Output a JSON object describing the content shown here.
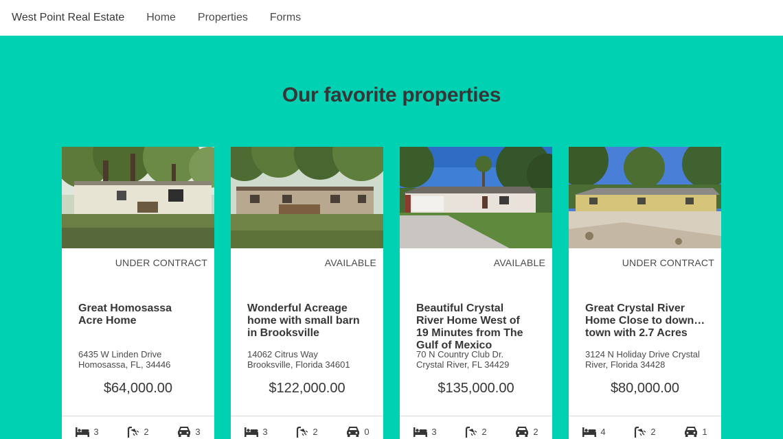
{
  "nav": {
    "brand": "West Point Real Estate",
    "links": [
      "Home",
      "Properties",
      "Forms"
    ]
  },
  "hero": {
    "title": "Our favorite properties"
  },
  "icons": {
    "beds": "bed-icon",
    "baths": "shower-icon",
    "garage": "car-icon"
  },
  "colors": {
    "accent": "#00d1b2",
    "text": "#363636"
  },
  "properties": [
    {
      "status": "UNDER CONTRACT",
      "title_lines": [
        "Great Homosassa",
        "Acre Home"
      ],
      "address_lines": [
        "6435 W Linden Drive",
        "Homosassa, FL, 34446"
      ],
      "price": "$64,000.00",
      "beds": "3",
      "baths": "2",
      "garage": "3"
    },
    {
      "status": "AVAILABLE",
      "title_lines": [
        "Wonderful Acreage",
        "home with small barn",
        "in Brooksville"
      ],
      "address_lines": [
        "14062 Citrus Way",
        "Brooksville, Florida 34601"
      ],
      "price": "$122,000.00",
      "beds": "3",
      "baths": "2",
      "garage": "0"
    },
    {
      "status": "AVAILABLE",
      "title_lines": [
        "Beautiful Crystal",
        "River Home West of",
        "19 Minutes from The",
        "Gulf of Mexico"
      ],
      "address_lines": [
        "70 N Country Club Dr.",
        "Crystal River, FL 34429"
      ],
      "price": "$135,000.00",
      "beds": "3",
      "baths": "2",
      "garage": "2"
    },
    {
      "status": "UNDER CONTRACT",
      "title_lines": [
        "Great Crystal River",
        "Home Close to downtown",
        "town with 2.7 Acres"
      ],
      "address_lines": [
        "3124 N Holiday Drive Crystal",
        "River, Florida 34428"
      ],
      "price": "$80,000.00",
      "beds": "4",
      "baths": "2",
      "garage": "1"
    }
  ]
}
